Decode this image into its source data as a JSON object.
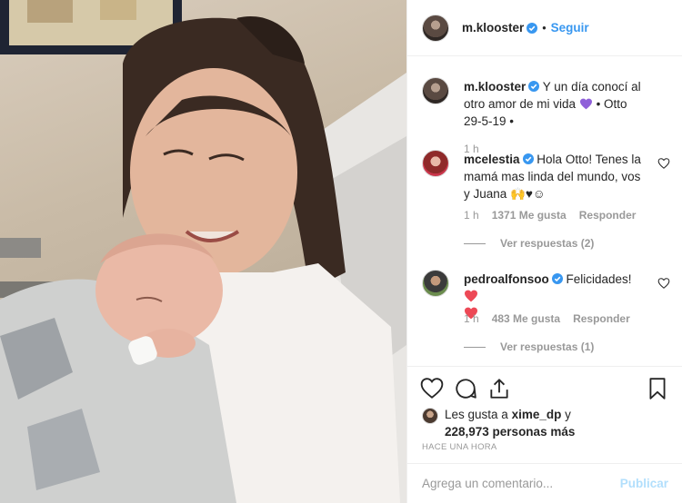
{
  "header": {
    "username": "m.klooster",
    "separator": "•",
    "follow_label": "Seguir"
  },
  "caption": {
    "username": "m.klooster",
    "text": " Y un día conocí al otro amor de mi vida ",
    "emoji_heart_color": "#8f60d9",
    "text_after": " • Otto 29-5-19 •",
    "time": "1 h"
  },
  "comments": [
    {
      "username": "mcelestia",
      "text": " Hola Otto! Tenes la mamá mas linda del mundo, vos y Juana 🙌♥☺",
      "time": "1 h",
      "likes": "1371 Me gusta",
      "reply_label": "Responder",
      "view_replies": "Ver respuestas (2)"
    },
    {
      "username": "pedroalfonsoo",
      "text": " Felicidades! ",
      "heart_color": "#ed4956",
      "time": "1 h",
      "likes": "483 Me gusta",
      "reply_label": "Responder",
      "view_replies": "Ver respuestas (1)"
    }
  ],
  "likes": {
    "prefix": "Les gusta a ",
    "first_user": "xime_dp",
    "mid": " y ",
    "count": "228,973 personas más"
  },
  "posted_ago": "HACE UNA HORA",
  "add_comment": {
    "placeholder": "Agrega un comentario...",
    "publish_label": "Publicar"
  },
  "colors": {
    "accent_blue": "#3897f0",
    "verified_blue": "#3897f0",
    "muted": "#999999"
  },
  "icons": [
    "heart-icon",
    "comment-icon",
    "share-icon",
    "bookmark-icon",
    "verified-badge-icon",
    "like-comment-icon"
  ]
}
